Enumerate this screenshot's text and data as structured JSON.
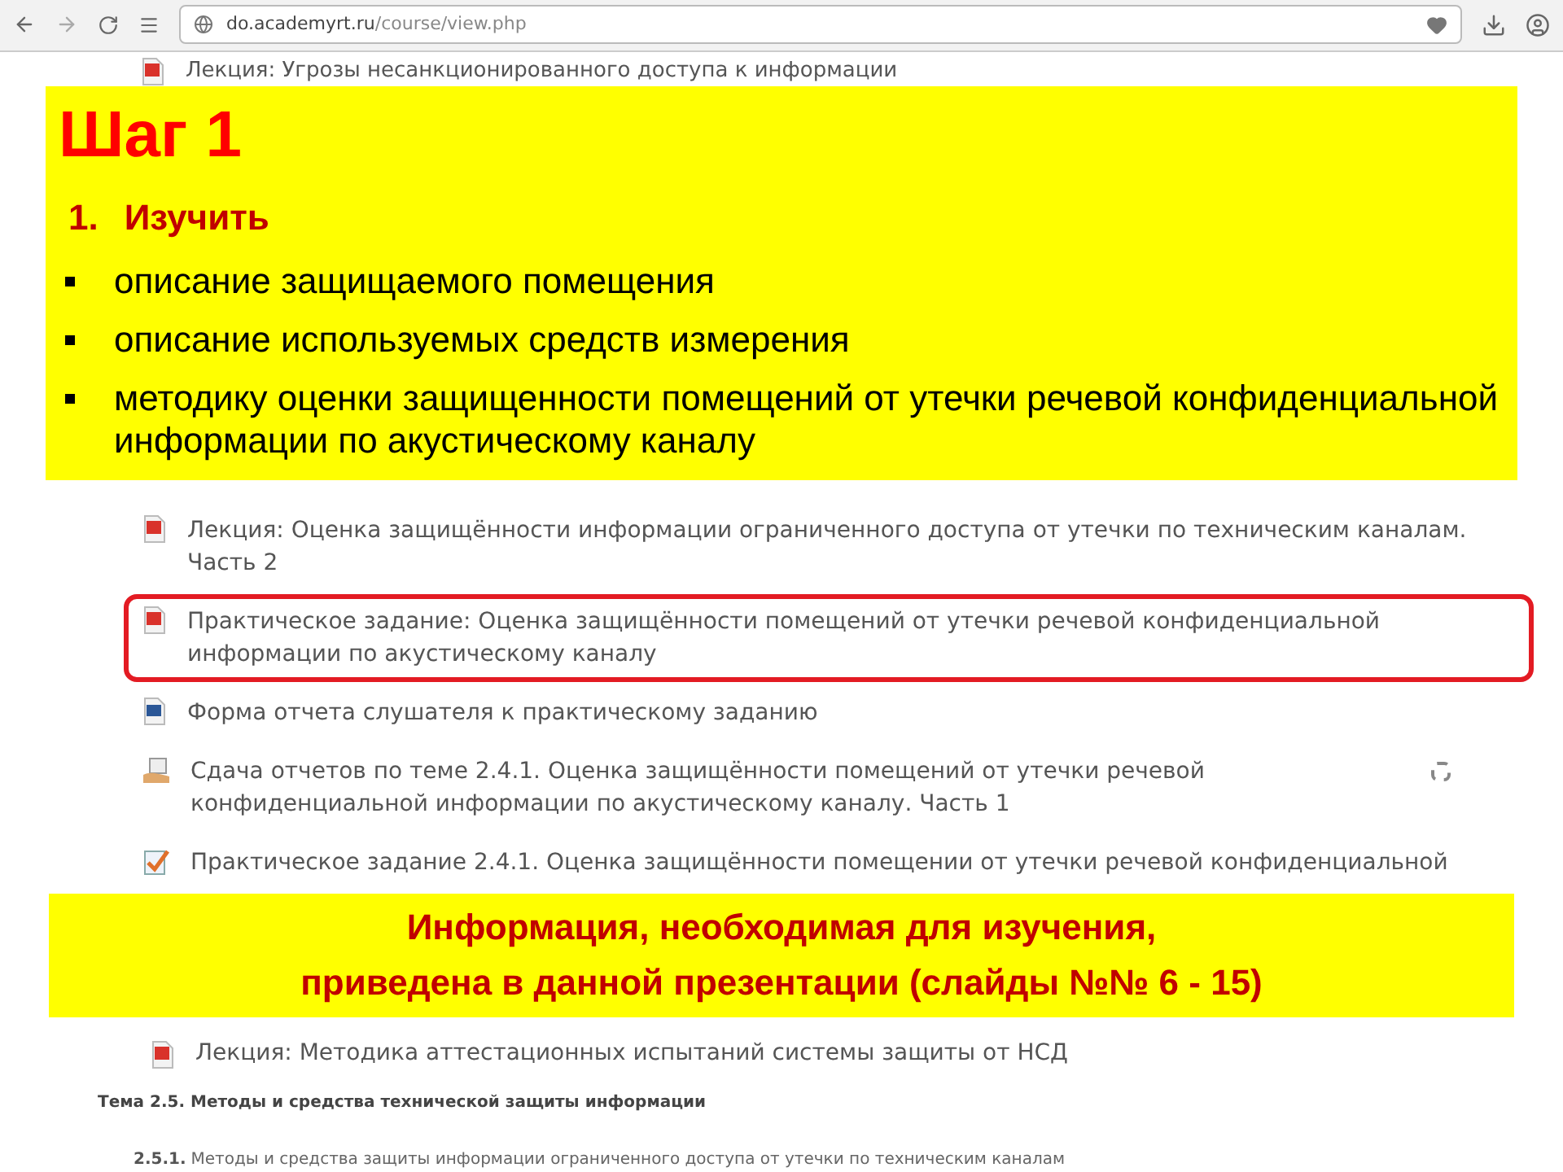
{
  "browser": {
    "url_host": "do.academyrt.ru",
    "url_path": "/course/view.php"
  },
  "top_item": {
    "kind": "pdf",
    "text": "Лекция: Угрозы несанкционированного доступа к информации"
  },
  "step_box": {
    "title": "Шаг 1",
    "numbered": "1.",
    "heading": "Изучить",
    "bullets": [
      "описание защищаемого помещения",
      "описание используемых средств измерения",
      "методику оценки защищенности помещений от утечки речевой конфиденциальной информации по акустическому каналу"
    ]
  },
  "items": [
    {
      "kind": "pdf",
      "text": "Лекция: Оценка защищённости информации ограниченного доступа от утечки по техническим каналам. Часть 2",
      "highlighted": false,
      "completion_box": false
    },
    {
      "kind": "pdf",
      "text": "Практическое задание: Оценка защищённости помещений от утечки речевой конфиденциальной информации по акустическому каналу",
      "highlighted": true,
      "completion_box": false
    },
    {
      "kind": "word",
      "text": "Форма отчета слушателя к практическому заданию",
      "highlighted": false,
      "completion_box": false
    },
    {
      "kind": "upload",
      "text": "Сдача отчетов по теме 2.4.1. Оценка защищённости помещений от утечки речевой конфиденциальной информации по акустическому каналу. Часть 1",
      "highlighted": false,
      "completion_box": true
    },
    {
      "kind": "assignment",
      "text": "Практическое задание 2.4.1. Оценка защищённости помещении от утечки речевой конфиденциальной",
      "highlighted": false,
      "completion_box": false
    }
  ],
  "info_box": {
    "lines": [
      "Информация, необходимая для изучения,",
      "приведена в данной презентации (слайды №№ 6 - 15)"
    ]
  },
  "bottom_item": {
    "kind": "pdf",
    "text": "Лекция: Методика аттестационных испытаний системы защиты от НСД"
  },
  "topic": {
    "title": "Тема 2.5. Методы и средства технической защиты информации"
  },
  "subtopic": {
    "number": "2.5.1.",
    "text": "Методы и средства защиты информации ограниченного доступа от утечки по техническим каналам"
  }
}
